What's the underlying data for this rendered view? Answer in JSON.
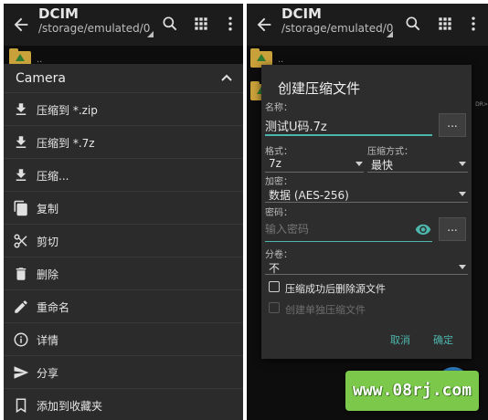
{
  "left_panel": {
    "appbar": {
      "title": "DCIM",
      "path": "/storage/emulated/0"
    },
    "list_dots": "..",
    "menu": {
      "header": "Camera",
      "items": [
        {
          "label": "压缩到 *.zip",
          "icon": "download-icon"
        },
        {
          "label": "压缩到 *.7z",
          "icon": "download-icon"
        },
        {
          "label": "压缩...",
          "icon": "download-icon"
        },
        {
          "label": "复制",
          "icon": "copy-icon"
        },
        {
          "label": "剪切",
          "icon": "scissors-icon"
        },
        {
          "label": "删除",
          "icon": "trash-icon"
        },
        {
          "label": "重命名",
          "icon": "pencil-icon"
        },
        {
          "label": "详情",
          "icon": "info-icon"
        },
        {
          "label": "分享",
          "icon": "send-icon"
        },
        {
          "label": "添加到收藏夹",
          "icon": "bookmark-icon"
        }
      ]
    }
  },
  "right_panel": {
    "appbar": {
      "title": "DCIM",
      "path": "/storage/emulated/0"
    },
    "list_dots": "..",
    "side_text": "DR>",
    "dialog": {
      "title": "创建压缩文件",
      "name_label": "名称：",
      "name_value": "测试U码.7z",
      "browse_label": "...",
      "format_label": "格式：",
      "format_value": "7z",
      "method_label": "压缩方式：",
      "method_value": "最快",
      "encrypt_label": "加密：",
      "encrypt_value": "数据 (AES-256)",
      "password_label": "密码：",
      "password_placeholder": "输入密码",
      "split_label": "分卷：",
      "split_value": "不",
      "delete_source_label": "压缩成功后删除源文件",
      "single_archive_label": "创建单独压缩文件",
      "cancel_label": "取消",
      "ok_label": "确定"
    }
  },
  "watermark": "www.08rj.com",
  "colors": {
    "accent": "#4db6ac",
    "folder": "#c9a13a",
    "background": "#121212",
    "menu": "#2b2b2b",
    "dialog": "#2d2d2d"
  }
}
